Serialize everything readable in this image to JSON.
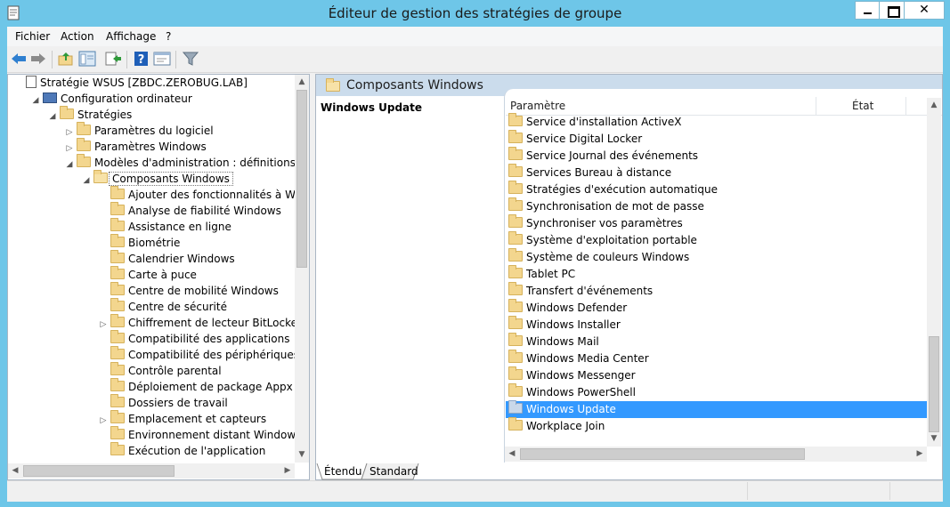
{
  "window": {
    "title": "Éditeur de gestion des stratégies de groupe",
    "controls": [
      "minimize",
      "maximize",
      "close"
    ]
  },
  "menubar": {
    "items": [
      "Fichier",
      "Action",
      "Affichage",
      "?"
    ]
  },
  "toolbar": {
    "buttons": [
      "back-icon",
      "forward-icon",
      "up-folder-icon",
      "show-hide-tree-icon",
      "export-list-icon",
      "help-icon",
      "properties-icon",
      "filter-icon"
    ]
  },
  "tree": {
    "items": [
      {
        "label": "Stratégie WSUS [ZBDC.ZEROBUG.LAB]",
        "depth": 0,
        "expander": "",
        "icon": "policy-document-icon"
      },
      {
        "label": "Configuration ordinateur",
        "depth": 1,
        "expander": "◢",
        "icon": "computer-icon"
      },
      {
        "label": "Stratégies",
        "depth": 2,
        "expander": "◢",
        "icon": "folder-icon"
      },
      {
        "label": "Paramètres du logiciel",
        "depth": 3,
        "expander": "▷",
        "icon": "folder-icon"
      },
      {
        "label": "Paramètres Windows",
        "depth": 3,
        "expander": "▷",
        "icon": "folder-icon"
      },
      {
        "label": "Modèles d'administration : définitions de strat",
        "depth": 3,
        "expander": "◢",
        "icon": "folder-icon"
      },
      {
        "label": "Composants Windows",
        "depth": 4,
        "expander": "◢",
        "icon": "folder-open-icon",
        "selected": true
      },
      {
        "label": "Ajouter des fonctionnalités à Windows",
        "depth": 5,
        "expander": "",
        "icon": "folder-icon"
      },
      {
        "label": "Analyse de fiabilité Windows",
        "depth": 5,
        "expander": "",
        "icon": "folder-icon"
      },
      {
        "label": "Assistance en ligne",
        "depth": 5,
        "expander": "",
        "icon": "folder-icon"
      },
      {
        "label": "Biométrie",
        "depth": 5,
        "expander": "",
        "icon": "folder-icon"
      },
      {
        "label": "Calendrier Windows",
        "depth": 5,
        "expander": "",
        "icon": "folder-icon"
      },
      {
        "label": "Carte à puce",
        "depth": 5,
        "expander": "",
        "icon": "folder-icon"
      },
      {
        "label": "Centre de mobilité Windows",
        "depth": 5,
        "expander": "",
        "icon": "folder-icon"
      },
      {
        "label": "Centre de sécurité",
        "depth": 5,
        "expander": "",
        "icon": "folder-icon"
      },
      {
        "label": "Chiffrement de lecteur BitLocker",
        "depth": 5,
        "expander": "▷",
        "icon": "folder-icon"
      },
      {
        "label": "Compatibilité des applications",
        "depth": 5,
        "expander": "",
        "icon": "folder-icon"
      },
      {
        "label": "Compatibilité des périphériques et des",
        "depth": 5,
        "expander": "",
        "icon": "folder-icon"
      },
      {
        "label": "Contrôle parental",
        "depth": 5,
        "expander": "",
        "icon": "folder-icon"
      },
      {
        "label": "Déploiement de package Appx",
        "depth": 5,
        "expander": "",
        "icon": "folder-icon"
      },
      {
        "label": "Dossiers de travail",
        "depth": 5,
        "expander": "",
        "icon": "folder-icon"
      },
      {
        "label": "Emplacement et capteurs",
        "depth": 5,
        "expander": "▷",
        "icon": "folder-icon"
      },
      {
        "label": "Environnement distant Windows",
        "depth": 5,
        "expander": "",
        "icon": "folder-icon"
      },
      {
        "label": "Exécution de l'application",
        "depth": 5,
        "expander": "",
        "icon": "folder-icon"
      }
    ]
  },
  "details": {
    "header_title": "Composants Windows",
    "selected_title": "Windows Update",
    "columns": [
      "Paramètre",
      "État"
    ],
    "rows": [
      "Service d'installation ActiveX",
      "Service Digital Locker",
      "Service Journal des événements",
      "Services Bureau à distance",
      "Stratégies d'exécution automatique",
      "Synchronisation de mot de passe",
      "Synchroniser vos paramètres",
      "Système d'exploitation portable",
      "Système de couleurs Windows",
      "Tablet PC",
      "Transfert d'événements",
      "Windows Defender",
      "Windows Installer",
      "Windows Mail",
      "Windows Media Center",
      "Windows Messenger",
      "Windows PowerShell",
      "Windows Update",
      "Workplace Join"
    ],
    "selected_row": "Windows Update"
  },
  "tabs": [
    "Étendu",
    "Standard"
  ],
  "colors": {
    "titlebar": "#6ec6e8",
    "selection": "#3399ff",
    "pane_header": "#cbdcec"
  }
}
